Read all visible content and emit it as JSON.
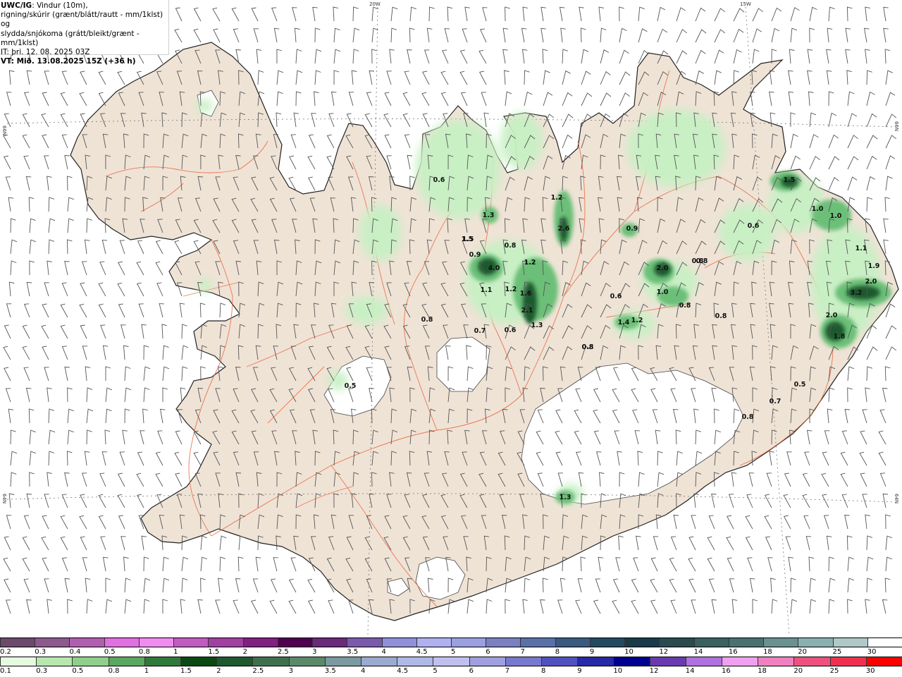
{
  "header": {
    "product": "UWC/IG",
    "description_line1": ": Vindur (10m),",
    "description_line2": "rigning/skúrir (grænt/blátt/rautt - mm/1klst) og",
    "description_line3": "slydda/snjókoma (grátt/bleikt/grænt - mm/1klst)",
    "issue_time": "IT: þri. 12. 08. 2025 03Z",
    "valid_time": "VT: Mið. 13.08.2025 15Z (+36 h)"
  },
  "graticule_labels": [
    {
      "text": "20W"
    },
    {
      "text": "15W"
    },
    {
      "text": "66N"
    },
    {
      "text": "66N"
    },
    {
      "text": "64N"
    },
    {
      "text": "64N"
    }
  ],
  "precip_labels": [
    "0.6",
    "1.5",
    "1.3",
    "1.5",
    "0.9",
    "0.8",
    "4.0",
    "1.1",
    "1.2",
    "1.2",
    "1.6",
    "2.1",
    "1.3",
    "1.2",
    "0.8",
    "0.8",
    "0.7",
    "0.6",
    "0.8",
    "0.5",
    "1.2",
    "2.6",
    "0.9",
    "2.0",
    "0.8",
    "1.0",
    "0.8",
    "0.6",
    "1.4",
    "1.2",
    "0.8",
    "0.8",
    "1.5",
    "1.0",
    "1.0",
    "0.6",
    "1.1",
    "1.9",
    "2.0",
    "3.2",
    "2.0",
    "1.8",
    "0.5",
    "0.7",
    "0.8",
    "1.3"
  ],
  "colors": {
    "land": "#efe3d6",
    "sea": "#ffffff",
    "coast": "#222222",
    "roads": "#e8643a",
    "glacier": "#ffffff",
    "light_green": "#c8f0c4",
    "mid_green": "#6cbf78",
    "dark_green": "#1f5a2e",
    "wind_barb": "#555555"
  },
  "legend_snow": {
    "labels": [
      "0.2",
      "0.3",
      "0.4",
      "0.5",
      "0.8",
      "1",
      "1.5",
      "2",
      "2.5",
      "3",
      "3.5",
      "4",
      "4.5",
      "5",
      "6",
      "7",
      "8",
      "9",
      "10",
      "12",
      "14",
      "16",
      "18",
      "20",
      "25",
      "30"
    ],
    "colors": [
      "#6b4a6b",
      "#8c5a8c",
      "#b05fb0",
      "#e070e0",
      "#f08cf0",
      "#c05cc0",
      "#a040a0",
      "#802080",
      "#500050",
      "#6a2a7a",
      "#7a5aaa",
      "#9090d8",
      "#b0b0f0",
      "#9aa0e0",
      "#7a80c0",
      "#5a70a8",
      "#3a5a80",
      "#244a60",
      "#1a3a4a",
      "#2a4a50",
      "#3a6060",
      "#4a7070",
      "#6a9090",
      "#8ab0b0",
      "#b0c8c8",
      "#ffffff"
    ]
  },
  "legend_rain": {
    "labels": [
      "0.1",
      "0.3",
      "0.5",
      "0.8",
      "1",
      "1.5",
      "2",
      "2.5",
      "3",
      "3.5",
      "4",
      "4.5",
      "5",
      "6",
      "7",
      "8",
      "9",
      "10",
      "12",
      "14",
      "16",
      "18",
      "20",
      "25",
      "30"
    ],
    "colors": [
      "#e6fae0",
      "#b6e8ae",
      "#8ed08a",
      "#5aa860",
      "#2e7a3a",
      "#0a4a12",
      "#1e5a2e",
      "#3e7050",
      "#5a8a6a",
      "#7a9aa0",
      "#9aaad0",
      "#b0b8e8",
      "#c0c0f0",
      "#a0a0e0",
      "#7878d0",
      "#5050c0",
      "#2828a8",
      "#000090",
      "#6a3ab0",
      "#b070e0",
      "#f0a0f0",
      "#f080c0",
      "#f05080",
      "#f03050",
      "#ff0000"
    ]
  }
}
